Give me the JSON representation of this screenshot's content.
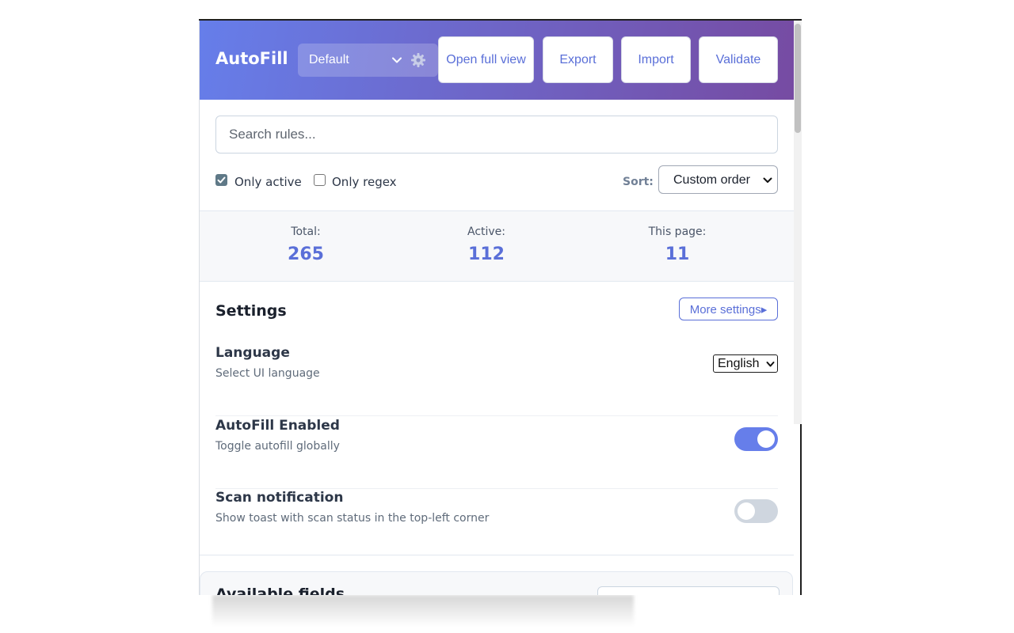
{
  "header": {
    "app_title": "AutoFill",
    "profile": "Default",
    "buttons": {
      "open_full_view": "Open full view",
      "export": "Export",
      "import": "Import",
      "validate": "Validate"
    }
  },
  "filters": {
    "search_placeholder": "Search rules...",
    "only_active": {
      "label": "Only active",
      "checked": true
    },
    "only_regex": {
      "label": "Only regex",
      "checked": false
    },
    "sort_label": "Sort:",
    "sort_value": "Custom order"
  },
  "stats": {
    "total": {
      "label": "Total:",
      "value": "265"
    },
    "active": {
      "label": "Active:",
      "value": "112"
    },
    "this_page": {
      "label": "This page:",
      "value": "11"
    }
  },
  "settings": {
    "title": "Settings",
    "more_label": "More settings▸",
    "language": {
      "name": "Language",
      "desc": "Select UI language",
      "value": "English"
    },
    "autofill_enabled": {
      "name": "AutoFill Enabled",
      "desc": "Toggle autofill globally",
      "on": true
    },
    "scan_notification": {
      "name": "Scan notification",
      "desc": "Show toast with scan status in the top-left corner",
      "on": false
    }
  },
  "fields": {
    "title": "Available fields"
  },
  "colors": {
    "accent": "#667eea",
    "accent_end": "#764ba2",
    "link": "#5a6fd8"
  }
}
